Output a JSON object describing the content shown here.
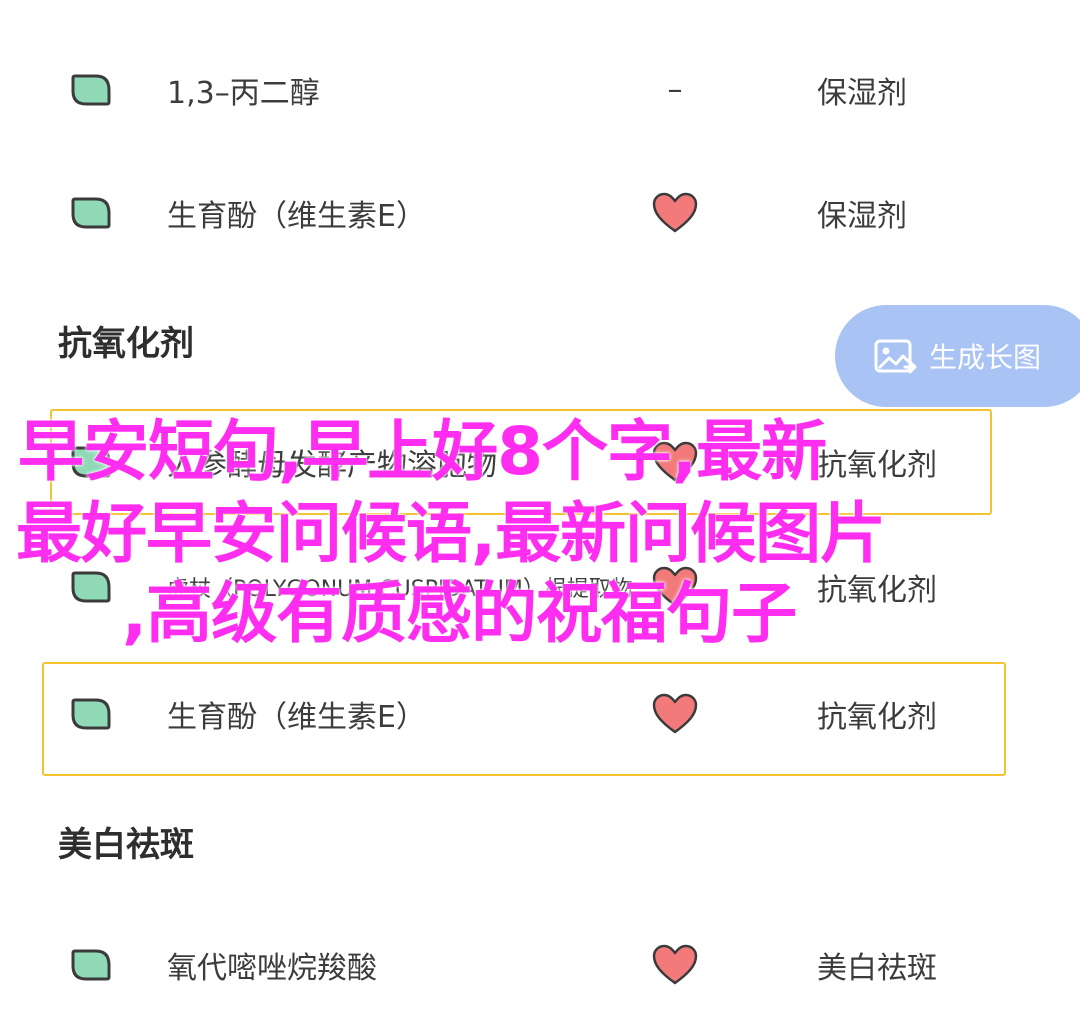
{
  "rows": [
    {
      "name": "1,3–丙二醇",
      "rating_text": "–",
      "effect": "保湿剂"
    },
    {
      "name": "生育酚（维生素E）",
      "rating_icon": "heart-icon",
      "effect": "保湿剂"
    },
    {
      "name": "人参酵母发酵产物溶胞物",
      "rating_icon": "heart-icon",
      "effect": "抗氧化剂"
    },
    {
      "name": "虎杖（POLYGONUM CUSPIDATUM）根提取物",
      "rating_icon": "heart-icon",
      "effect": "抗氧化剂"
    },
    {
      "name": "生育酚（维生素E）",
      "rating_icon": "heart-icon",
      "effect": "抗氧化剂"
    },
    {
      "name": "氧代嘧唑烷羧酸",
      "rating_icon": "heart-icon",
      "effect": "美白祛斑"
    }
  ],
  "sections": {
    "antioxidant": "抗氧化剂",
    "whitening": "美白祛斑"
  },
  "generate_button": {
    "label": "生成长图",
    "icon": "image-icon"
  },
  "overlay": {
    "line1": "早安短句,早上好8个字,最新",
    "line2": "最好早安问候语,最新问候图片",
    "line3": ",高级有质感的祝福句子"
  },
  "colors": {
    "leaf_fill": "#8fd9b6",
    "leaf_stroke": "#3b3b3b",
    "heart_fill": "#f27a7a",
    "highlight_border": "#f2c230",
    "button_bg": "#a9c3f5",
    "overlay_text": "#ff2df0"
  }
}
